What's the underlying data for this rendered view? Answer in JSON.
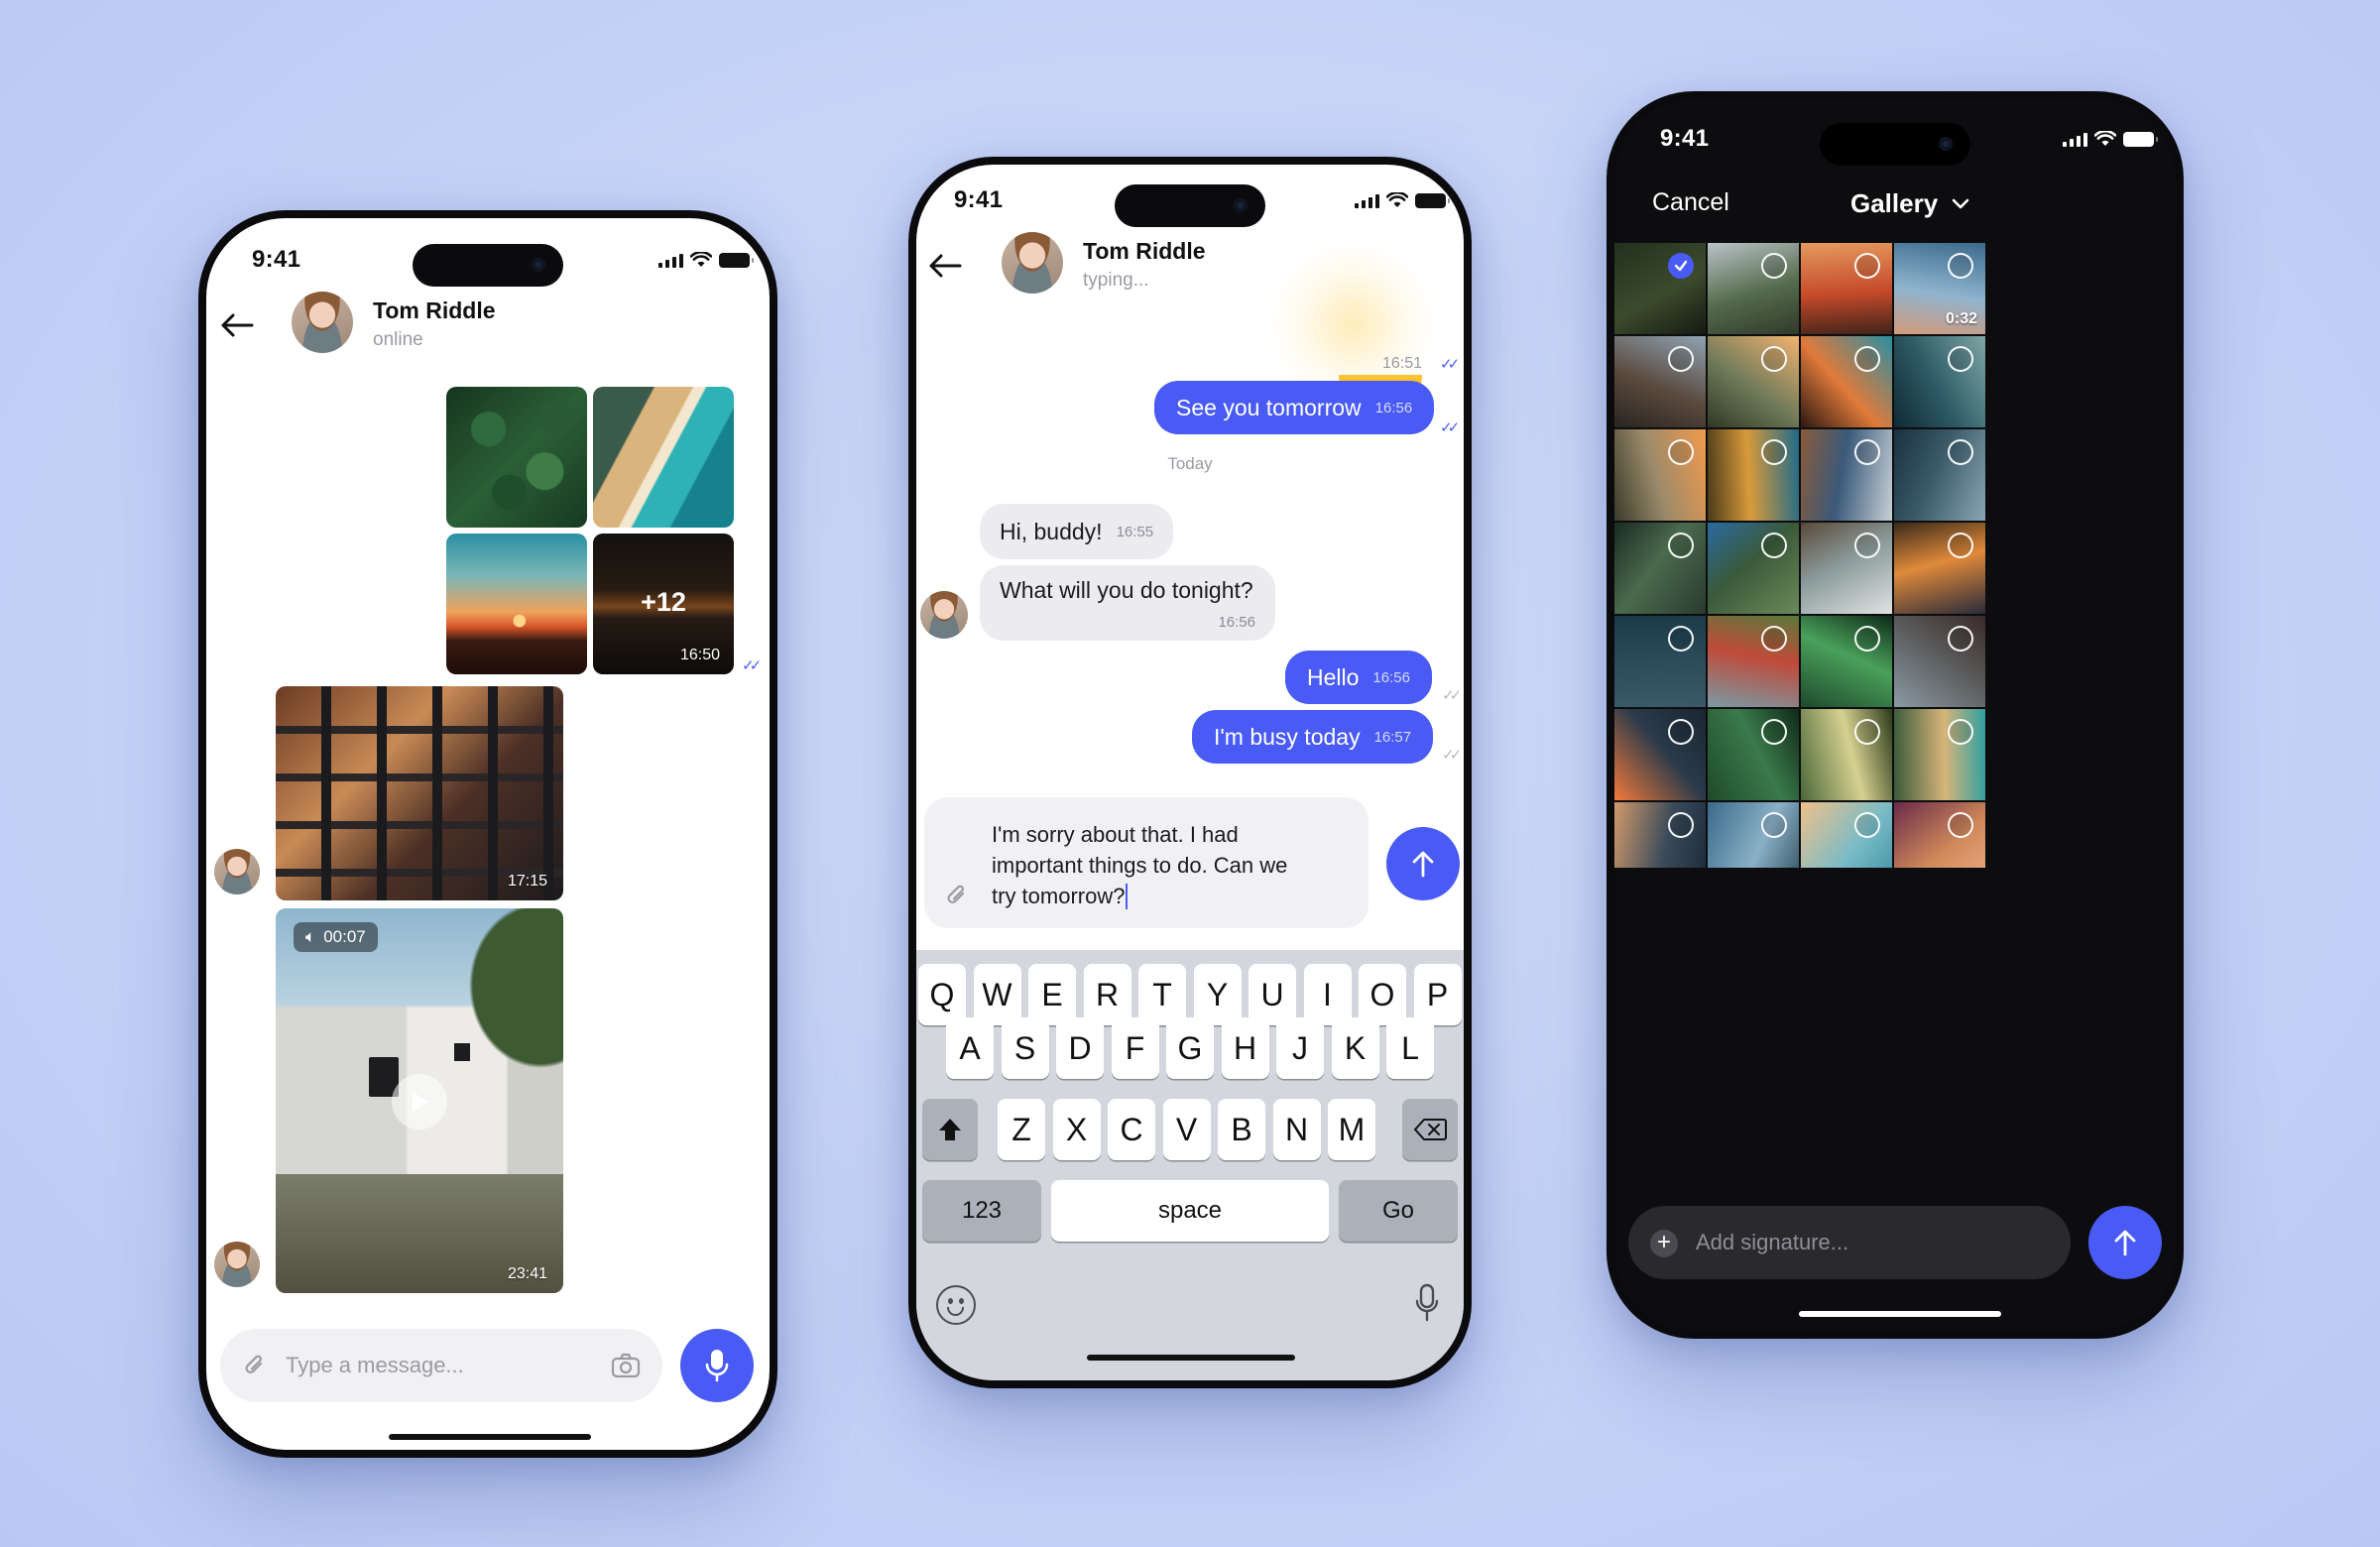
{
  "phone1": {
    "time": "9:41",
    "contact": {
      "name": "Tom Riddle",
      "status": "online"
    },
    "album": {
      "more_count": "+12",
      "time": "16:50"
    },
    "building_photo_time": "17:15",
    "video": {
      "duration": "00:07",
      "time": "23:41"
    },
    "input": {
      "placeholder": "Type a message..."
    }
  },
  "phone2": {
    "time": "9:41",
    "contact": {
      "name": "Tom Riddle",
      "status": "typing..."
    },
    "top_time": "16:51",
    "messages": [
      {
        "text": "See you tomorrow",
        "time": "16:56"
      },
      {
        "text": "Hi, buddy!",
        "time": "16:55"
      },
      {
        "text": "What will you do tonight?",
        "time": "16:56"
      },
      {
        "text": "Hello",
        "time": "16:56"
      },
      {
        "text": "I'm busy today",
        "time": "16:57"
      }
    ],
    "date_separator": "Today",
    "draft": {
      "line1": "I'm sorry about that. I had",
      "line2": "important things to do. Can we",
      "line3": "try tomorrow?"
    },
    "keyboard": {
      "row1": [
        "Q",
        "W",
        "E",
        "R",
        "T",
        "Y",
        "U",
        "I",
        "O",
        "P"
      ],
      "row2": [
        "A",
        "S",
        "D",
        "F",
        "G",
        "H",
        "J",
        "K",
        "L"
      ],
      "row3": [
        "Z",
        "X",
        "C",
        "V",
        "B",
        "N",
        "M"
      ],
      "numbers": "123",
      "space": "space",
      "go": "Go"
    }
  },
  "phone3": {
    "time": "9:41",
    "cancel": "Cancel",
    "title": "Gallery",
    "video_duration": "0:32",
    "input": {
      "placeholder": "Add signature..."
    }
  },
  "colors": {
    "accent": "#4a5bf5",
    "incoming": "#ececf0",
    "dark_bg": "#0d0d0f"
  }
}
